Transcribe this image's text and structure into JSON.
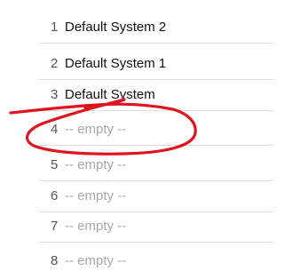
{
  "systems_list": {
    "items": [
      {
        "number": "1",
        "name": "Default System 2",
        "empty": false
      },
      {
        "number": "2",
        "name": "Default System 1",
        "empty": false
      },
      {
        "number": "3",
        "name": "Default System",
        "empty": false
      },
      {
        "number": "4",
        "name": "-- empty --",
        "empty": true
      },
      {
        "number": "5",
        "name": "-- empty --",
        "empty": true
      },
      {
        "number": "6",
        "name": "-- empty --",
        "empty": true
      },
      {
        "number": "7",
        "name": "-- empty --",
        "empty": true
      },
      {
        "number": "8",
        "name": "-- empty --",
        "empty": true
      }
    ]
  },
  "annotation": {
    "color": "#e0141e",
    "description_hint": "hand-drawn red circle around row 4"
  }
}
